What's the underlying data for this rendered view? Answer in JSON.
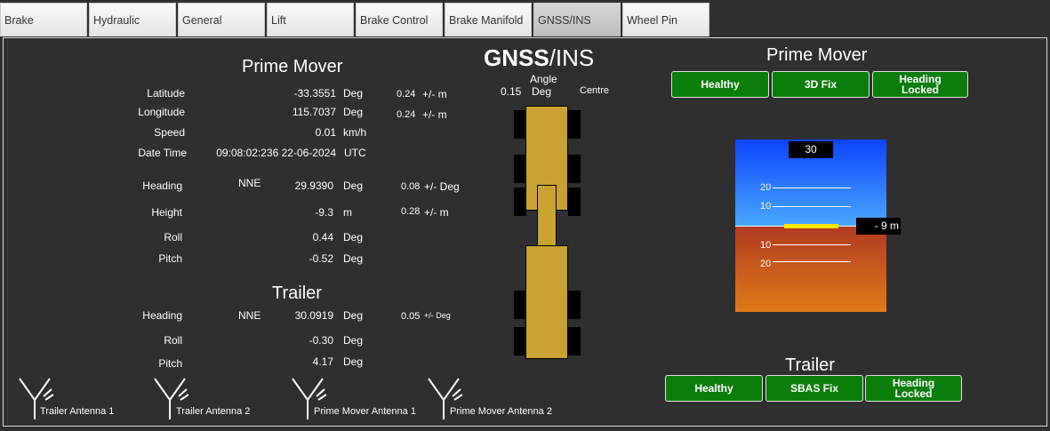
{
  "tabs": [
    "Brake",
    "Hydraulic",
    "General",
    "Lift",
    "Brake Control",
    "Brake Manifold",
    "GNSS/INS",
    "Wheel Pin"
  ],
  "active_tab": "GNSS/INS",
  "center": {
    "title_bold": "GNSS",
    "title_rest": "/INS",
    "angle_value": "0.15",
    "angle_label_1": "Angle",
    "angle_label_2": "Deg",
    "centre_label": "Centre"
  },
  "prime_mover": {
    "title": "Prime Mover",
    "latitude": {
      "label": "Latitude",
      "value": "-33.3551",
      "unit": "Deg",
      "acc": "0.24",
      "acc_unit": "+/- m"
    },
    "longitude": {
      "label": "Longitude",
      "value": "115.7037",
      "unit": "Deg",
      "acc": "0.24",
      "acc_unit": "+/- m"
    },
    "speed": {
      "label": "Speed",
      "value": "0.01",
      "unit": "km/h"
    },
    "datetime": {
      "label": "Date Time",
      "value": "09:08:02:236 22-06-2024",
      "unit": "UTC"
    },
    "heading": {
      "label": "Heading",
      "dir": "NNE",
      "value": "29.9390",
      "unit": "Deg",
      "acc": "0.08",
      "acc_unit": "+/- Deg"
    },
    "height": {
      "label": "Height",
      "value": "-9.3",
      "unit": "m",
      "acc": "0.28",
      "acc_unit": "+/- m"
    },
    "roll": {
      "label": "Roll",
      "value": "0.44",
      "unit": "Deg"
    },
    "pitch": {
      "label": "Pitch",
      "value": "-0.52",
      "unit": "Deg"
    }
  },
  "trailer": {
    "title": "Trailer",
    "heading": {
      "label": "Heading",
      "dir": "NNE",
      "value": "30.0919",
      "unit": "Deg",
      "acc": "0.05",
      "acc_unit": "+/- Deg"
    },
    "roll": {
      "label": "Roll",
      "value": "-0.30",
      "unit": "Deg"
    },
    "pitch": {
      "label": "Pitch",
      "value": "4.17",
      "unit": "Deg"
    }
  },
  "antennas": [
    "Trailer Antenna 1",
    "Trailer Antenna 2",
    "Prime Mover Antenna 1",
    "Prime Mover Antenna 2"
  ],
  "status_prime_mover": {
    "title": "Prime Mover",
    "buttons": [
      {
        "line1": "Healthy",
        "line2": ""
      },
      {
        "line1": "3D Fix",
        "line2": ""
      },
      {
        "line1": "Heading",
        "line2": "Locked"
      }
    ]
  },
  "status_trailer": {
    "title": "Trailer",
    "buttons": [
      {
        "line1": "Healthy",
        "line2": ""
      },
      {
        "line1": "SBAS Fix",
        "line2": ""
      },
      {
        "line1": "Heading",
        "line2": "Locked"
      }
    ]
  },
  "attitude": {
    "heading_box": "30",
    "height_box": "- 9 m",
    "pitch_labels_up": [
      "20",
      "10"
    ],
    "pitch_labels_down": [
      "10",
      "20"
    ]
  },
  "colors": {
    "status_green": "#0b7d0b",
    "truck": "#c9a232",
    "marker": "#ffe600"
  }
}
